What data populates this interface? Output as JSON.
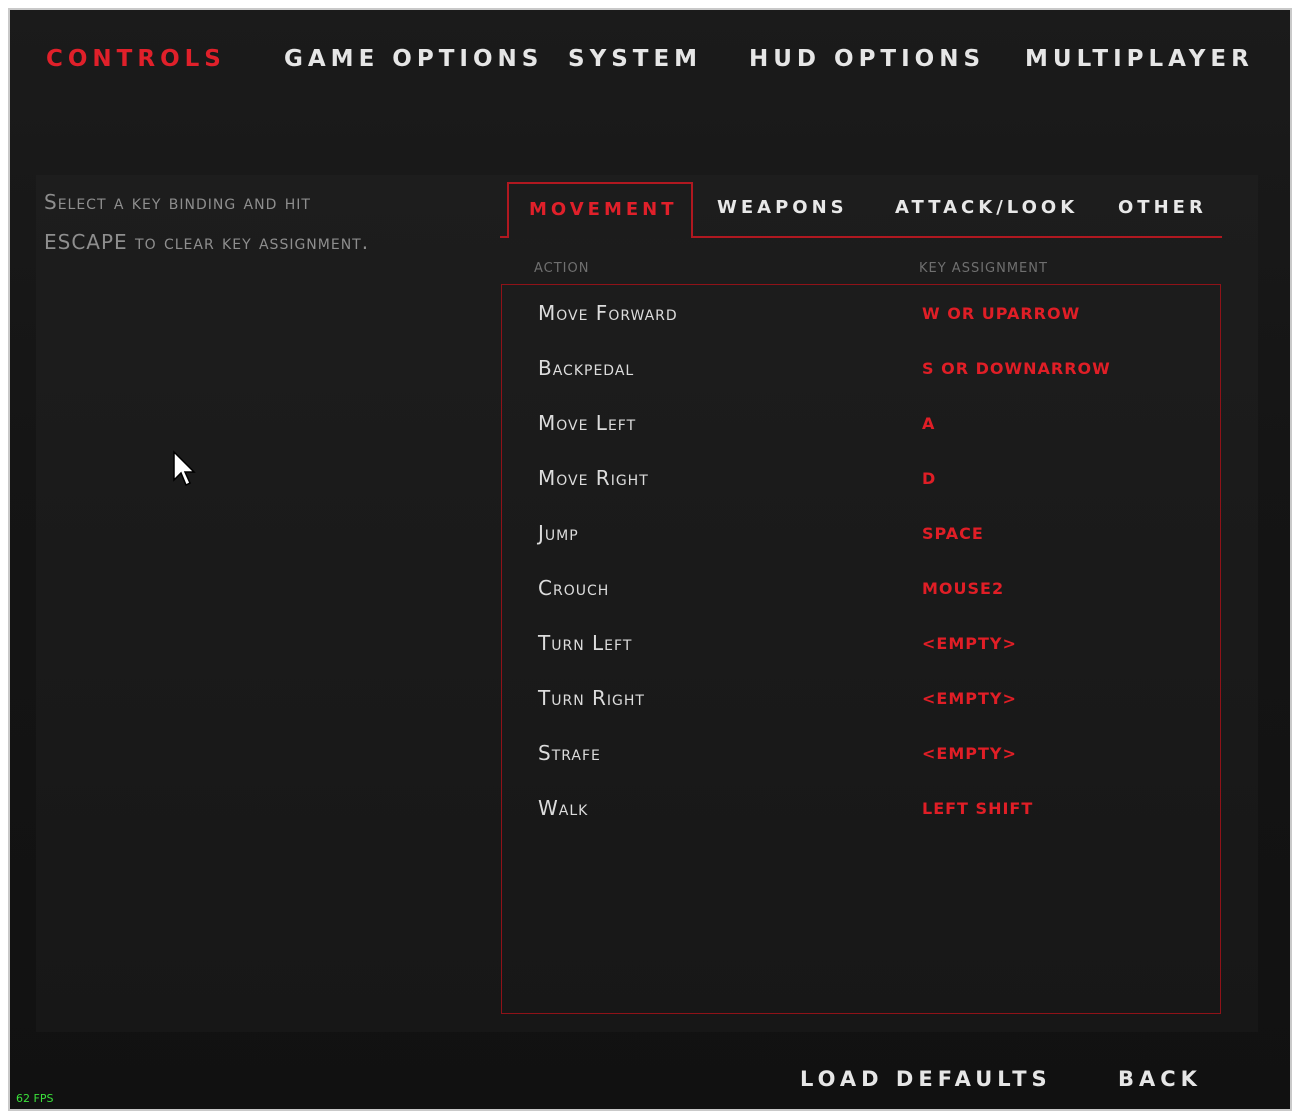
{
  "top_tabs": [
    {
      "label": "CONTROLS",
      "active": true
    },
    {
      "label": "GAME OPTIONS",
      "active": false
    },
    {
      "label": "SYSTEM",
      "active": false
    },
    {
      "label": "HUD OPTIONS",
      "active": false
    },
    {
      "label": "MULTIPLAYER",
      "active": false
    }
  ],
  "hint": {
    "line1": "Select a key binding and hit",
    "line2": "ESCAPE to clear key assignment."
  },
  "sub_tabs": [
    {
      "label": "MOVEMENT",
      "active": true
    },
    {
      "label": "WEAPONS",
      "active": false
    },
    {
      "label": "ATTACK/LOOK",
      "active": false
    },
    {
      "label": "OTHER",
      "active": false
    }
  ],
  "columns": {
    "action": "ACTION",
    "key": "KEY ASSIGNMENT"
  },
  "bindings": [
    {
      "action": "Move Forward",
      "key": "W OR UPARROW"
    },
    {
      "action": "Backpedal",
      "key": "S OR DOWNARROW"
    },
    {
      "action": "Move Left",
      "key": "A"
    },
    {
      "action": "Move Right",
      "key": "D"
    },
    {
      "action": "Jump",
      "key": "SPACE"
    },
    {
      "action": "Crouch",
      "key": "MOUSE2"
    },
    {
      "action": "Turn Left",
      "key": "<EMPTY>"
    },
    {
      "action": "Turn Right",
      "key": "<EMPTY>"
    },
    {
      "action": "Strafe",
      "key": "<EMPTY>"
    },
    {
      "action": "Walk",
      "key": "LEFT SHIFT"
    }
  ],
  "buttons": {
    "load_defaults": "LOAD DEFAULTS",
    "back": "BACK"
  },
  "fps": "62 FPS",
  "colors": {
    "accent": "#e0202a",
    "text": "#e6e6e6",
    "background": "#161616",
    "fps": "#3be23b"
  }
}
